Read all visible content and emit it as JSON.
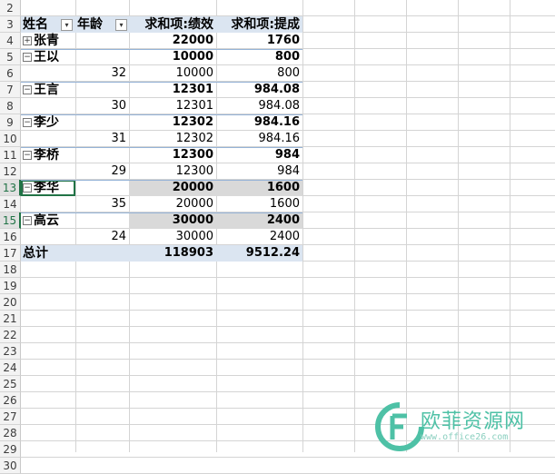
{
  "sheet": {
    "row_numbers": [
      "2",
      "3",
      "4",
      "5",
      "6",
      "7",
      "8",
      "9",
      "10",
      "11",
      "12",
      "13",
      "14",
      "15",
      "16",
      "17",
      "18",
      "19",
      "20",
      "21",
      "22",
      "23",
      "24",
      "25",
      "26",
      "27",
      "28",
      "29",
      "30"
    ],
    "active_rows": [
      "13",
      "15"
    ]
  },
  "pivot": {
    "headers": {
      "name": "姓名",
      "age": "年龄",
      "perf": "求和项:绩效",
      "comm": "求和项:提成"
    },
    "rows": [
      {
        "toggle": "⊞",
        "name": "张青",
        "age": "",
        "perf": "22000",
        "comm": "1760",
        "bold": true
      },
      {
        "toggle": "⊟",
        "name": "王以",
        "age": "",
        "perf": "10000",
        "comm": "800",
        "bold": true
      },
      {
        "toggle": "",
        "name": "",
        "age": "32",
        "perf": "10000",
        "comm": "800",
        "bold": false
      },
      {
        "toggle": "⊟",
        "name": "王言",
        "age": "",
        "perf": "12301",
        "comm": "984.08",
        "bold": true
      },
      {
        "toggle": "",
        "name": "",
        "age": "30",
        "perf": "12301",
        "comm": "984.08",
        "bold": false
      },
      {
        "toggle": "⊟",
        "name": "李少",
        "age": "",
        "perf": "12302",
        "comm": "984.16",
        "bold": true
      },
      {
        "toggle": "",
        "name": "",
        "age": "31",
        "perf": "12302",
        "comm": "984.16",
        "bold": false
      },
      {
        "toggle": "⊟",
        "name": "李桥",
        "age": "",
        "perf": "12300",
        "comm": "984",
        "bold": true
      },
      {
        "toggle": "",
        "name": "",
        "age": "29",
        "perf": "12300",
        "comm": "984",
        "bold": false
      },
      {
        "toggle": "⊟",
        "name": "李华",
        "age": "",
        "perf": "20000",
        "comm": "1600",
        "bold": true
      },
      {
        "toggle": "",
        "name": "",
        "age": "35",
        "perf": "20000",
        "comm": "1600",
        "bold": false
      },
      {
        "toggle": "⊟",
        "name": "高云",
        "age": "",
        "perf": "30000",
        "comm": "2400",
        "bold": true
      },
      {
        "toggle": "",
        "name": "",
        "age": "24",
        "perf": "30000",
        "comm": "2400",
        "bold": false
      }
    ],
    "total": {
      "label": "总计",
      "perf": "118903",
      "comm": "9512.24"
    }
  },
  "watermark": {
    "text": "欧菲资源网",
    "url": "www.office26.com",
    "color": "#4ec1a6"
  },
  "colors": {
    "header_fill": "#dbe5f1",
    "gray_fill": "#d9d9d9",
    "grid_line": "#d4d4d4",
    "selection": "#217346"
  }
}
